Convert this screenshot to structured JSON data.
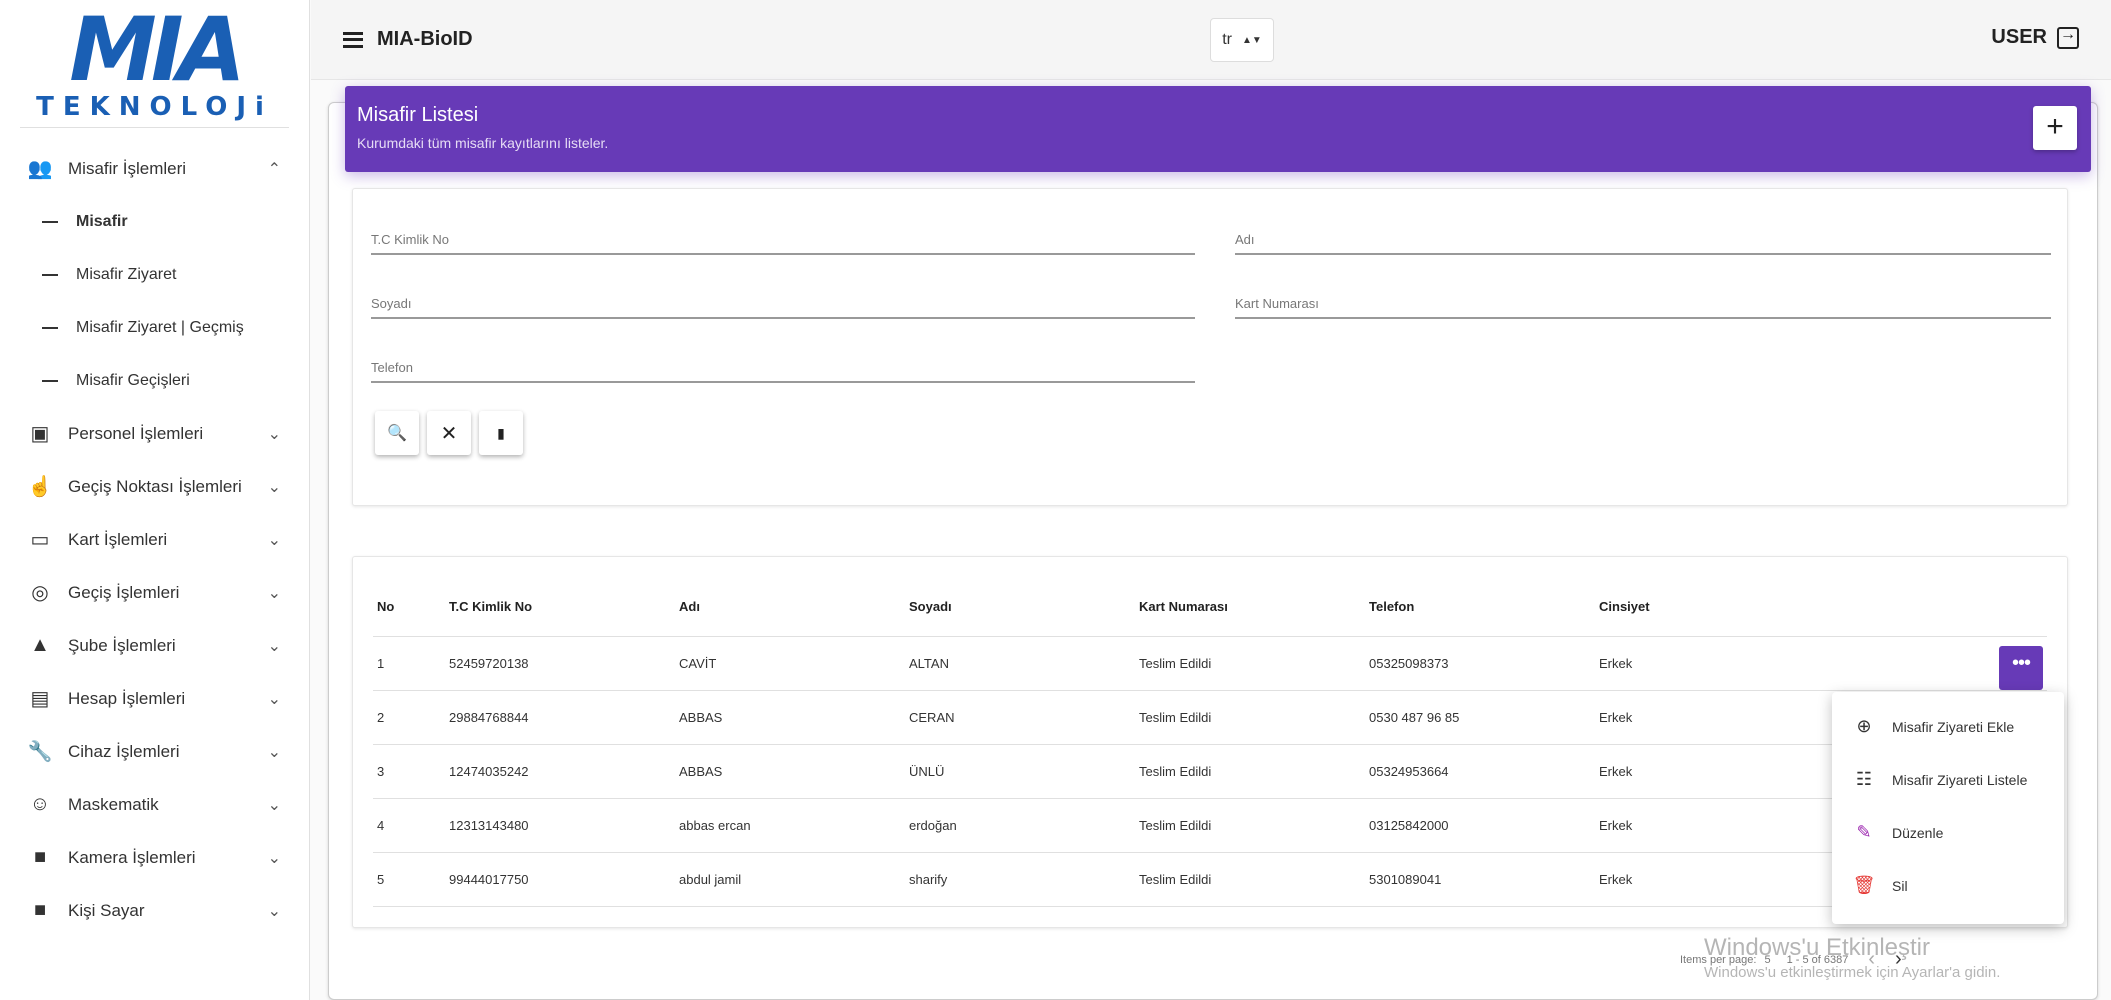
{
  "sidebar": {
    "logo_main": "MIA",
    "logo_sub": "TEKNOLOJi",
    "groups": [
      {
        "label": "Misafir İşlemleri",
        "icon": "people-icon",
        "glyph": "👥",
        "chevron": "⌃",
        "expanded": true,
        "children": [
          {
            "label": "Misafir",
            "active": true
          },
          {
            "label": "Misafir Ziyaret",
            "active": false
          },
          {
            "label": "Misafir Ziyaret | Geçmiş",
            "active": false
          },
          {
            "label": "Misafir Geçişleri",
            "active": false
          }
        ]
      },
      {
        "label": "Personel İşlemleri",
        "icon": "id-card-icon",
        "glyph": "▣",
        "chevron": "⌄"
      },
      {
        "label": "Geçiş Noktası İşlemleri",
        "icon": "touch-icon",
        "glyph": "☝",
        "chevron": "⌄"
      },
      {
        "label": "Kart İşlemleri",
        "icon": "credit-card-icon",
        "glyph": "▭",
        "chevron": "⌄"
      },
      {
        "label": "Geçiş İşlemleri",
        "icon": "fingerprint-icon",
        "glyph": "◎",
        "chevron": "⌄"
      },
      {
        "label": "Şube İşlemleri",
        "icon": "shapes-icon",
        "glyph": "▲",
        "chevron": "⌄"
      },
      {
        "label": "Hesap İşlemleri",
        "icon": "account-box-icon",
        "glyph": "▤",
        "chevron": "⌄"
      },
      {
        "label": "Cihaz İşlemleri",
        "icon": "wrench-icon",
        "glyph": "🔧",
        "chevron": "⌄"
      },
      {
        "label": "Maskematik",
        "icon": "smiley-icon",
        "glyph": "☺",
        "chevron": "⌄"
      },
      {
        "label": "Kamera İşlemleri",
        "icon": "videocam-icon",
        "glyph": "■",
        "chevron": "⌄"
      },
      {
        "label": "Kişi Sayar",
        "icon": "videocam-icon",
        "glyph": "■",
        "chevron": "⌄"
      }
    ]
  },
  "topbar": {
    "app_title": "MIA-BioID",
    "language": "tr",
    "user_label": "USER"
  },
  "header": {
    "title": "Misafir Listesi",
    "subtitle": "Kurumdaki tüm misafir kayıtlarını listeler.",
    "add_label": "+"
  },
  "filters": {
    "tc": "T.C Kimlik No",
    "adi": "Adı",
    "soyadi": "Soyadı",
    "kart": "Kart Numarası",
    "telefon": "Telefon",
    "search_glyph": "🔍",
    "clear_glyph": "✕",
    "export_glyph": "▮"
  },
  "table": {
    "headers": [
      "No",
      "T.C Kimlik No",
      "Adı",
      "Soyadı",
      "Kart Numarası",
      "Telefon",
      "Cinsiyet"
    ],
    "rows": [
      [
        "1",
        "52459720138",
        "CAVİT",
        "ALTAN",
        "Teslim Edildi",
        "05325098373",
        "Erkek"
      ],
      [
        "2",
        "29884768844",
        "ABBAS",
        "CERAN",
        "Teslim Edildi",
        "0530 487 96 85",
        "Erkek"
      ],
      [
        "3",
        "12474035242",
        "ABBAS",
        "ÜNLÜ",
        "Teslim Edildi",
        "05324953664",
        "Erkek"
      ],
      [
        "4",
        "12313143480",
        "abbas ercan",
        "erdoğan",
        "Teslim Edildi",
        "03125842000",
        "Erkek"
      ],
      [
        "5",
        "99444017750",
        "abdul jamil",
        "sharify",
        "Teslim Edildi",
        "5301089041",
        "Erkek"
      ]
    ],
    "action_glyph": "•••"
  },
  "context_menu": {
    "items": [
      {
        "label": "Misafir Ziyareti Ekle",
        "icon": "add-circle-icon",
        "glyph": "⊕",
        "color": "#333333"
      },
      {
        "label": "Misafir Ziyareti Listele",
        "icon": "list-icon",
        "glyph": "☷",
        "color": "#333333"
      },
      {
        "label": "Düzenle",
        "icon": "edit-icon",
        "glyph": "✎",
        "color": "#9c27b0"
      },
      {
        "label": "Sil",
        "icon": "delete-icon",
        "glyph": "🗑",
        "color": "#e53935"
      }
    ]
  },
  "pagination": {
    "items_per_page_label": "Items per page:",
    "items_per_page_value": "5",
    "range": "1 - 5 of 6387",
    "prev": "‹",
    "next": "›"
  },
  "watermark": {
    "line1": "Windows'u Etkinleştir",
    "line2": "Windows'u etkinleştirmek için Ayarlar'a gidin."
  },
  "colors": {
    "accent": "#673ab7",
    "logo": "#1a5fb4"
  }
}
